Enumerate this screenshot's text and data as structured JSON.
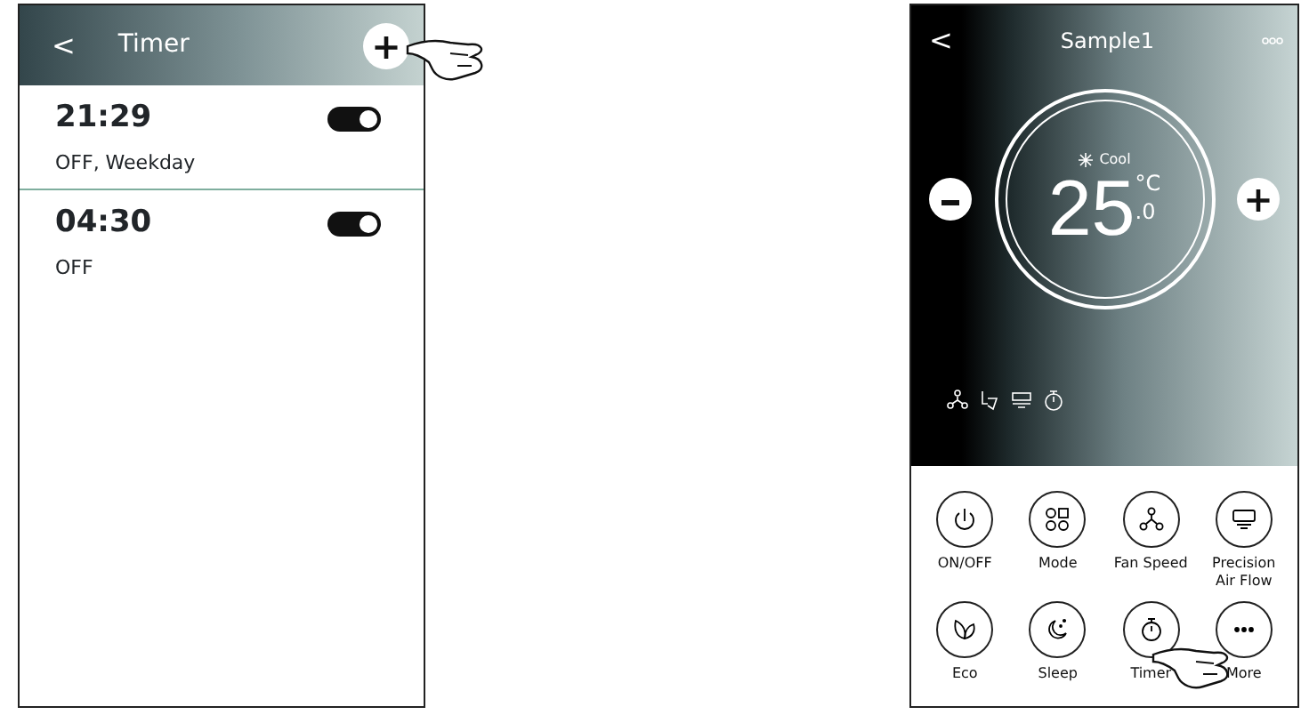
{
  "timer_screen": {
    "back": "<",
    "title": "Timer",
    "add": "+",
    "timers": [
      {
        "time": "21:29",
        "detail": "OFF, Weekday",
        "on": true
      },
      {
        "time": "04:30",
        "detail": "OFF",
        "on": true
      }
    ]
  },
  "control_screen": {
    "back": "<",
    "title": "Sample1",
    "mode": "Cool",
    "temperature": "25",
    "unit": "°C",
    "decimal": ".0",
    "plus": "+",
    "buttons": [
      {
        "label": "ON/OFF",
        "kind": "power"
      },
      {
        "label": "Mode",
        "kind": "mode"
      },
      {
        "label": "Fan Speed",
        "kind": "fan"
      },
      {
        "label": "Precision Air Flow",
        "kind": "airflow"
      },
      {
        "label": "Eco",
        "kind": "eco"
      },
      {
        "label": "Sleep",
        "kind": "sleep"
      },
      {
        "label": "Timer",
        "kind": "timer"
      },
      {
        "label": "More",
        "kind": "more"
      }
    ]
  }
}
